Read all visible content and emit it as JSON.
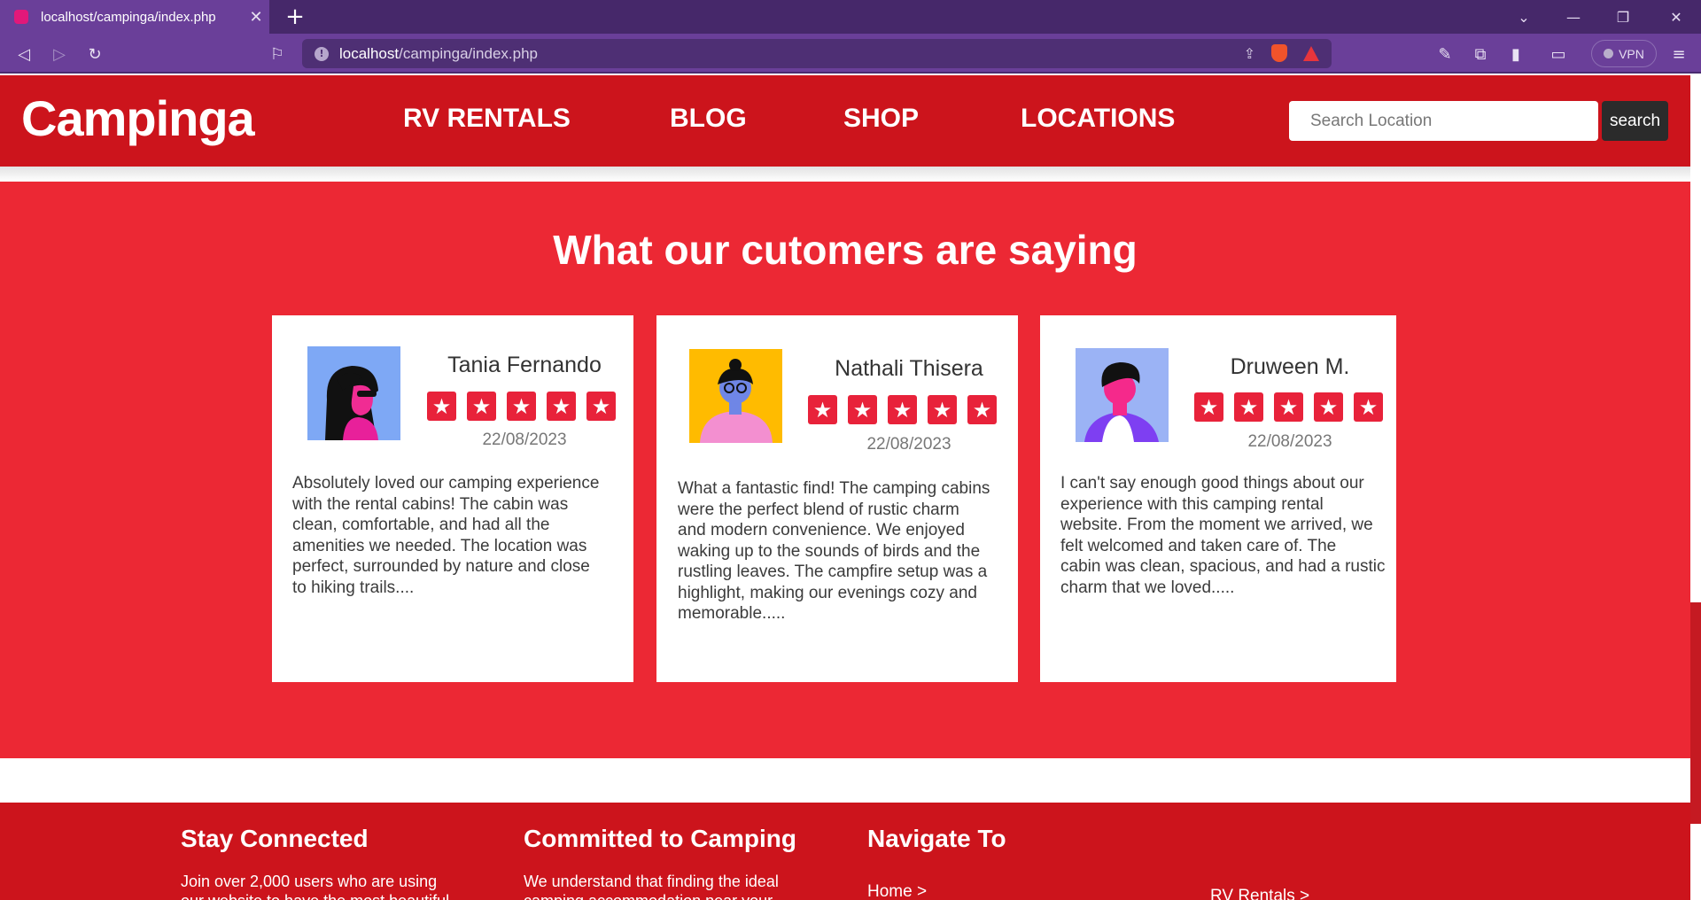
{
  "browser": {
    "tab_title": "localhost/campinga/index.php",
    "url_host": "localhost",
    "url_path": "/campinga/index.php",
    "vpn_label": "VPN"
  },
  "header": {
    "logo": "Campinga",
    "menu": [
      "RV RENTALS",
      "BLOG",
      "SHOP",
      "LOCATIONS"
    ],
    "search_placeholder": "Search Location",
    "search_button": "search"
  },
  "testimonials": {
    "title": "What our cutomers are saying",
    "rating_max": 5,
    "cards": [
      {
        "name": "Tania Fernando",
        "rating": 5,
        "date": "22/08/2023",
        "avatar": "woman-sunglasses-avatar",
        "text": [
          "Absolutely loved our camping experience",
          "with the rental cabins! The cabin was",
          "clean, comfortable, and had all the",
          "amenities we needed. The location was",
          "perfect, surrounded by nature and close",
          "to hiking trails...."
        ]
      },
      {
        "name": "Nathali Thisera",
        "rating": 5,
        "date": "22/08/2023",
        "avatar": "woman-glasses-avatar",
        "text": [
          "What a fantastic find! The camping cabins",
          "were the perfect blend of rustic charm",
          "and modern convenience. We enjoyed",
          "waking up to the sounds of birds and the",
          "rustling leaves. The campfire setup was a",
          "highlight, making our evenings cozy and",
          "memorable....."
        ]
      },
      {
        "name": "Druween M.",
        "rating": 5,
        "date": "22/08/2023",
        "avatar": "man-avatar",
        "text": [
          "I can't say enough good things about our",
          "experience with this camping rental",
          "website. From the moment we arrived, we",
          "felt welcomed and taken care of. The",
          "cabin was clean, spacious, and had a rustic",
          "charm that we loved....."
        ]
      }
    ]
  },
  "footer": {
    "stay_connected": {
      "title": "Stay Connected",
      "text": [
        "Join over 2,000 users who are using",
        "our website to have the most beautiful"
      ]
    },
    "committed": {
      "title": "Committed to Camping",
      "text": [
        "We understand that finding the ideal",
        "camping accommodation near your"
      ]
    },
    "navigate": {
      "title": "Navigate To",
      "links": [
        "Home >",
        "RV Rentals >"
      ]
    }
  },
  "colors": {
    "header_red": "#cc141c",
    "section_red": "#ec2834",
    "star_red": "#e8223a",
    "browser_purple": "#6a3f99"
  }
}
